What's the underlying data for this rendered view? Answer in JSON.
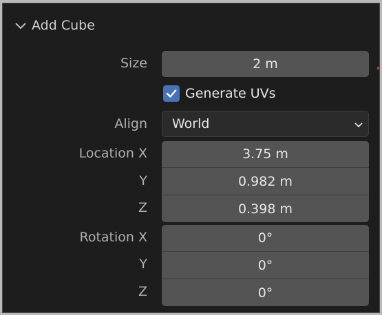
{
  "panel": {
    "title": "Add Cube",
    "icons": {
      "collapse": "chevron-down-icon",
      "check": "checkmark-icon",
      "dropdown": "chevron-down-icon"
    },
    "colors": {
      "background": "#1d1d1d",
      "field": "#545454",
      "checkbox": "#4772b3",
      "label": "#b0b0b0"
    }
  },
  "size": {
    "label": "Size",
    "value": "2 m"
  },
  "generate_uvs": {
    "label": "Generate UVs",
    "checked": true
  },
  "align": {
    "label": "Align",
    "value": "World"
  },
  "location": {
    "x_label": "Location X",
    "x_value": "3.75 m",
    "y_label": "Y",
    "y_value": "0.982 m",
    "z_label": "Z",
    "z_value": "0.398 m"
  },
  "rotation": {
    "x_label": "Rotation X",
    "x_value": "0°",
    "y_label": "Y",
    "y_value": "0°",
    "z_label": "Z",
    "z_value": "0°"
  }
}
